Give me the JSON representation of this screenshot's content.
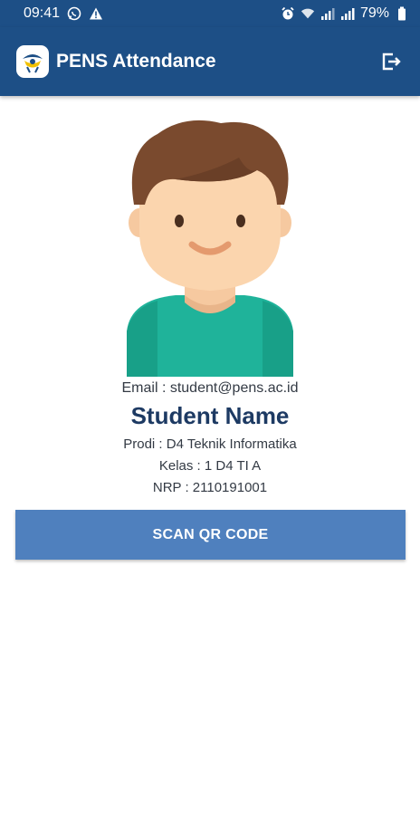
{
  "status_bar": {
    "time": "09:41",
    "battery": "79%",
    "left_icons": [
      "whatsapp-icon",
      "warning-icon"
    ],
    "right_icons": [
      "alarm-icon",
      "wifi-icon",
      "signal-icon",
      "signal-icon",
      "battery-icon"
    ]
  },
  "app_bar": {
    "title": "PENS Attendance",
    "logo_icon": "pens-logo-icon",
    "action_icon": "logout-icon"
  },
  "profile": {
    "avatar_icon": "student-avatar-icon",
    "email": "Email : student@pens.ac.id",
    "name": "Student Name",
    "prodi": "Prodi : D4 Teknik Informatika",
    "kelas": "Kelas : 1 D4 TI A",
    "nrp": "NRP : 2110191001"
  },
  "actions": {
    "scan_label": "SCAN QR CODE"
  },
  "colors": {
    "primary": "#1d4f86",
    "button": "#4f80be",
    "name_text": "#1d3a63"
  }
}
